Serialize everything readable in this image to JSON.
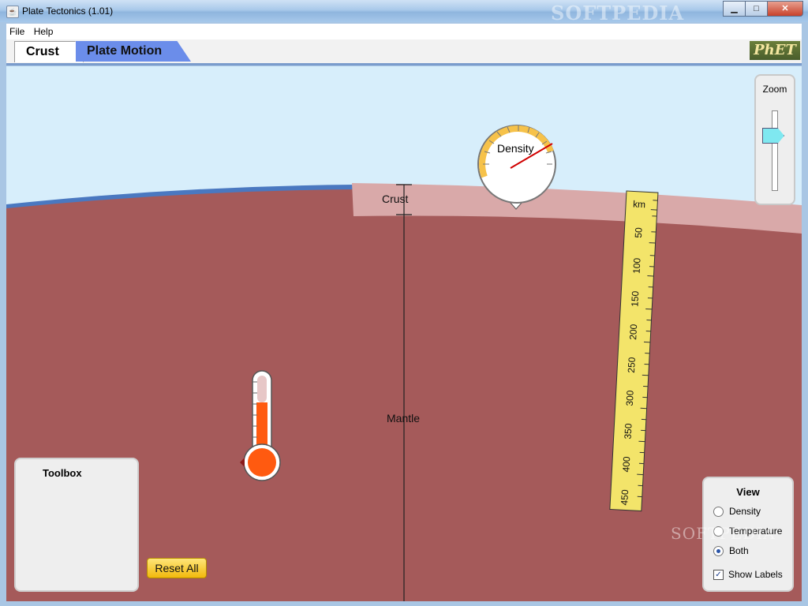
{
  "window": {
    "title": "Plate Tectonics (1.01)",
    "watermark": "SOFTPEDIA",
    "minimize": "▁",
    "maximize": "□",
    "close": "✕"
  },
  "menu": {
    "file": "File",
    "help": "Help"
  },
  "tabs": {
    "crust": "Crust",
    "plate_motion": "Plate Motion"
  },
  "logo": "PhET",
  "scene": {
    "crust_label": "Crust",
    "mantle_label": "Mantle",
    "density_label": "Density",
    "ruler_unit": "km",
    "ruler_ticks": [
      "50",
      "100",
      "150",
      "200",
      "250",
      "300",
      "350",
      "400",
      "450"
    ]
  },
  "zoom": {
    "label": "Zoom"
  },
  "toolbox": {
    "title": "Toolbox",
    "reset_label": "Reset All"
  },
  "view": {
    "title": "View",
    "options": [
      "Density",
      "Temperature",
      "Both"
    ],
    "selected": "Both",
    "show_labels": "Show Labels",
    "show_labels_checked": true
  },
  "watermark_bottom": "SOFTPEDIA",
  "colors": {
    "sky": "#d7eefb",
    "mantle": "#a55a5a",
    "crust": "#dcaeae",
    "ruler": "#f3e46a",
    "thermometer_fill": "#ff5a10",
    "tab_active": "#ffffff",
    "tab_inactive": "#6b8dea",
    "reset_button": "#f5c42a"
  }
}
